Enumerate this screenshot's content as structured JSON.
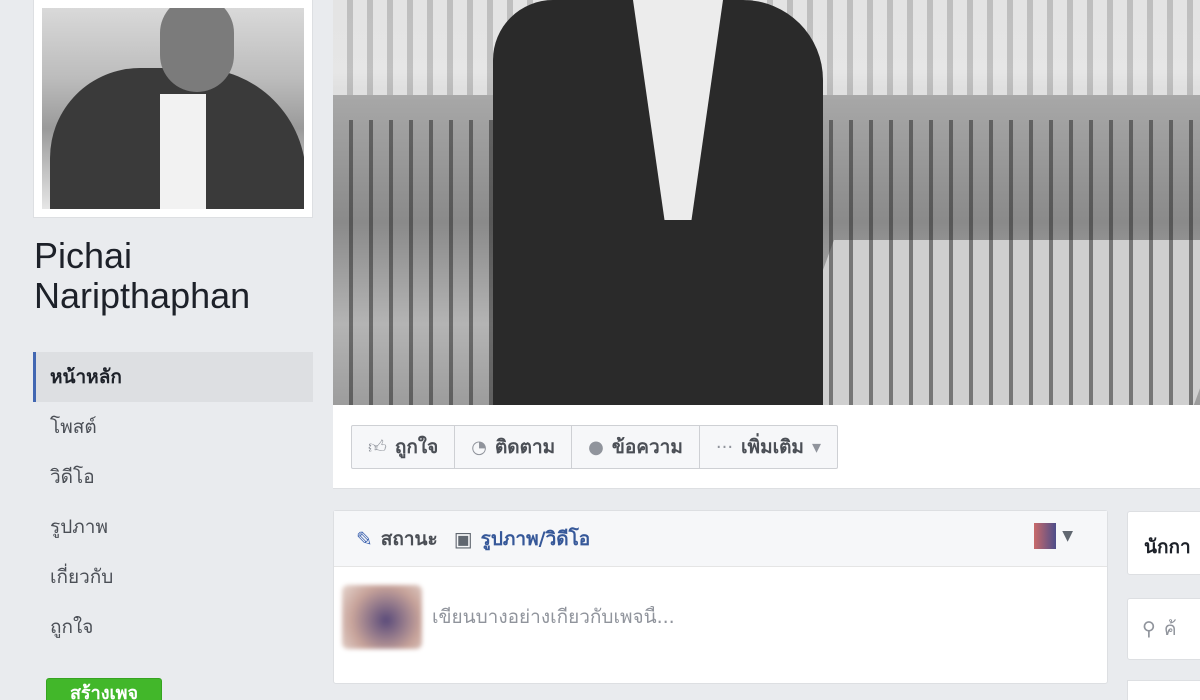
{
  "profile": {
    "name": "Pichai Naripthaphan"
  },
  "sidebar": {
    "items": [
      {
        "label": "หน้าหลัก",
        "active": true
      },
      {
        "label": "โพสต์"
      },
      {
        "label": "วิดีโอ"
      },
      {
        "label": "รูปภาพ"
      },
      {
        "label": "เกี่ยวกับ"
      },
      {
        "label": "ถูกใจ"
      }
    ],
    "create_page_label": "สร้างเพจ"
  },
  "actions": {
    "like_label": "ถูกใจ",
    "follow_label": "ติดตาม",
    "message_label": "ข้อความ",
    "more_label": "เพิ่มเติม"
  },
  "composer": {
    "status_tab": "สถานะ",
    "photo_video_tab": "รูปภาพ/วิดีโอ",
    "placeholder": "เขียนบางอย่างเกี่ยวกับเพจนี้..."
  },
  "right_column": {
    "card_text": "นักกา",
    "search_text": "ค้"
  },
  "colors": {
    "background": "#e9ebee",
    "link_blue": "#365899",
    "active_border": "#4267b2",
    "create_button": "#42b72a"
  }
}
